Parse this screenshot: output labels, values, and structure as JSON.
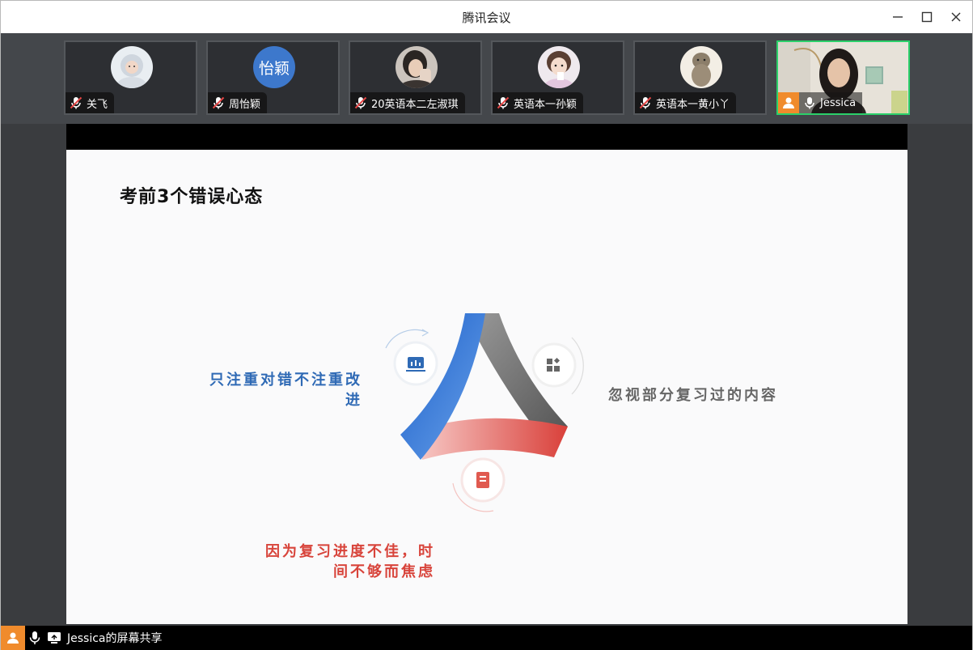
{
  "window": {
    "title": "腾讯会议"
  },
  "participants": [
    {
      "name": "关飞",
      "avatar_type": "photo",
      "mic": "muted"
    },
    {
      "name": "周怡颖",
      "avatar_type": "text",
      "avatar_text": "怡颖",
      "avatar_color": "#3d78cc",
      "mic": "muted"
    },
    {
      "name": "20英语本二左淑琪",
      "avatar_type": "photo",
      "mic": "muted"
    },
    {
      "name": "英语本一孙颖",
      "avatar_type": "photo",
      "mic": "muted"
    },
    {
      "name": "英语本一黄小丫",
      "avatar_type": "photo",
      "mic": "muted"
    },
    {
      "name": "Jessica",
      "avatar_type": "video",
      "mic": "on",
      "is_self": true,
      "active_speaker": true
    }
  ],
  "slide": {
    "title": "考前3个错误心态",
    "items": [
      {
        "text": "只注重对错不注重改进",
        "color": "#2f6ab5",
        "icon": "chart-icon"
      },
      {
        "text": "忽视部分复习过的内容",
        "color": "#666666",
        "icon": "apps-icon"
      },
      {
        "text": "因为复习进度不佳，时间不够而焦虑",
        "color": "#d8443b",
        "icon": "clipboard-icon"
      }
    ],
    "label_lines": {
      "blue_1": "只注重对错不注重改",
      "blue_2": "进",
      "gray_1": "忽视部分复习过的内容",
      "red_1": "因为复习进度不佳，时",
      "red_2": "间不够而焦虑"
    }
  },
  "bottombar": {
    "share_text": "Jessica的屏幕共享"
  },
  "colors": {
    "accent_green": "#2bd06a",
    "self_orange": "#f08b2c",
    "blue": "#2f6ab5",
    "red": "#d8443b",
    "gray": "#808080"
  }
}
